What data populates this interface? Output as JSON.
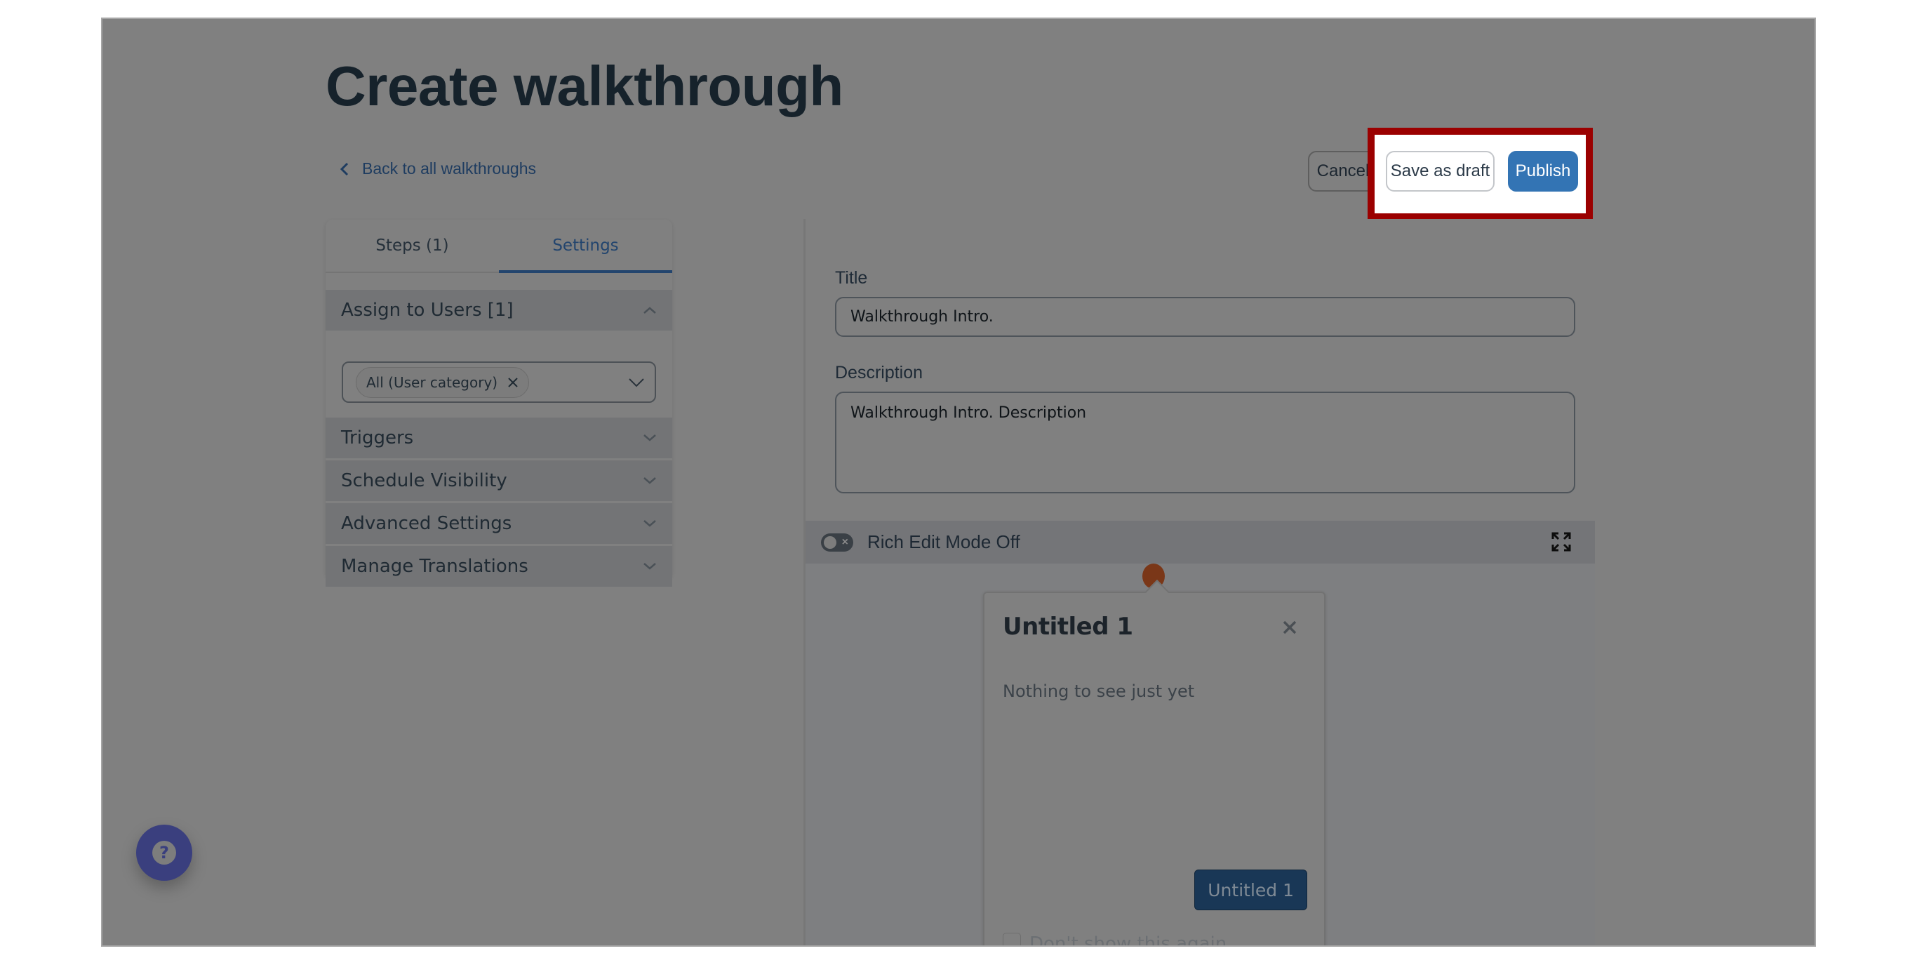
{
  "header": {
    "title": "Create walkthrough",
    "back_link": "Back to all walkthroughs"
  },
  "actions": {
    "cancel": "Cancel",
    "save_draft": "Save as draft",
    "publish": "Publish",
    "highlight_color": "#9b0000",
    "publish_color": "#3374b4"
  },
  "left_panel": {
    "tabs": [
      {
        "label": "Steps (1)",
        "active": false
      },
      {
        "label": "Settings",
        "active": true
      }
    ],
    "sections": [
      {
        "label": "Assign to Users [1]",
        "expanded": true
      },
      {
        "label": "Triggers",
        "expanded": false
      },
      {
        "label": "Schedule Visibility",
        "expanded": false
      },
      {
        "label": "Advanced Settings",
        "expanded": false
      },
      {
        "label": "Manage Translations",
        "expanded": false
      }
    ],
    "assign_users": {
      "selected_chip": "All (User category)"
    }
  },
  "form": {
    "title_label": "Title",
    "title_value": "Walkthrough Intro.",
    "description_label": "Description",
    "description_value": "Walkthrough Intro. Description"
  },
  "editor": {
    "rich_edit_label": "Rich Edit Mode Off",
    "rich_edit_on": false
  },
  "preview": {
    "step_title": "Untitled 1",
    "step_body": "Nothing to see just yet",
    "step_button": "Untitled 1",
    "dont_show_label": "Don't show this again",
    "beacon_color": "#7a3718"
  },
  "help": {
    "icon": "question-icon"
  }
}
